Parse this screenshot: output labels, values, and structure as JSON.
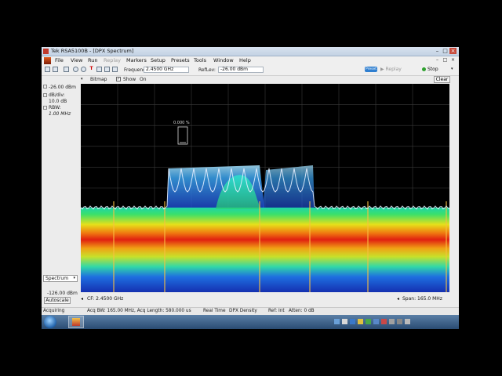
{
  "window": {
    "title": "Tek RSA5100B - [DPX Spectrum]"
  },
  "menu": [
    "File",
    "View",
    "Run",
    "Replay",
    "Markers",
    "Setup",
    "Presets",
    "Tools",
    "Window",
    "Help"
  ],
  "toolbar": {
    "frequency_label": "Frequency:",
    "frequency_value": "2.4500 GHz",
    "reflev_label": "RefLev:",
    "reflev_value": "-26.00 dBm",
    "preset_label": "Preset",
    "replay_label": "Replay",
    "stop_label": "Stop"
  },
  "display_toolbar": {
    "bitmap_label": "Bitmap",
    "show_label": "Show",
    "on_label": "On",
    "clear_label": "Clear"
  },
  "left_panel": {
    "ref_level": "-26.00 dBm",
    "db_div_label": "dB/div:",
    "db_div_value": "10.0 dB",
    "rbw_label": "RBW:",
    "rbw_value": "1.00 MHz",
    "bottom_level": "-126.00 dBm",
    "trace_select": "Spectrum",
    "autoscale_label": "Autoscale"
  },
  "plot": {
    "marker_readout": "0.000 %",
    "cf_label": "CF: 2.4500 GHz",
    "span_label": "Span: 165.0 MHz"
  },
  "status_bar": {
    "acquiring": "Acquiring",
    "acq_bw": "Acq BW: 165.00 MHz, Acq Length: 580.000 us",
    "real_time": "Real Time",
    "dpx_density": "DPX Density",
    "ref": "Ref: Int",
    "atten": "Atten: 0 dB"
  },
  "colors": {
    "plot_bg": "#000000",
    "grid": "#3a3a3a",
    "trace": "#e6f0ff",
    "preset_button": "#2f7fd0"
  },
  "icons": [
    "windows-start-icon",
    "rsa-app-taskbar-icon",
    "play-green-icon"
  ]
}
